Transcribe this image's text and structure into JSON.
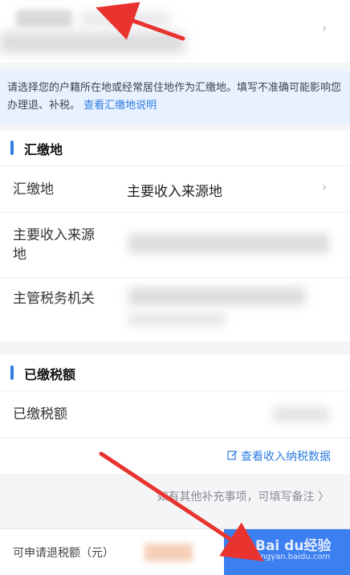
{
  "notice": {
    "text": "请选择您的户籍所在地或经常居住地作为汇缴地。填写不准确可能影响您办理退、补税。",
    "link": "查看汇缴地说明"
  },
  "section1": {
    "title": "汇缴地"
  },
  "rows": {
    "huijiaodi_label": "汇缴地",
    "huijiaodi_value": "主要收入来源地",
    "income_source_label_1": "主要收入来源",
    "income_source_label_2": "地",
    "tax_office_label": "主管税务机关"
  },
  "section2": {
    "title": "已缴税额"
  },
  "paid": {
    "label": "已缴税额"
  },
  "link_row": {
    "text": "查看收入纳税数据"
  },
  "note_row": {
    "text": "如有其他补充事项，可填写备注"
  },
  "bottom": {
    "refund_label": "可申请退税额（元）",
    "watermark": "Bai du经验",
    "watermark_sub": "jingyan.baidu.com"
  },
  "colors": {
    "accent": "#2f7de1",
    "button": "#3c7ff0",
    "arrow": "#e8332f"
  }
}
